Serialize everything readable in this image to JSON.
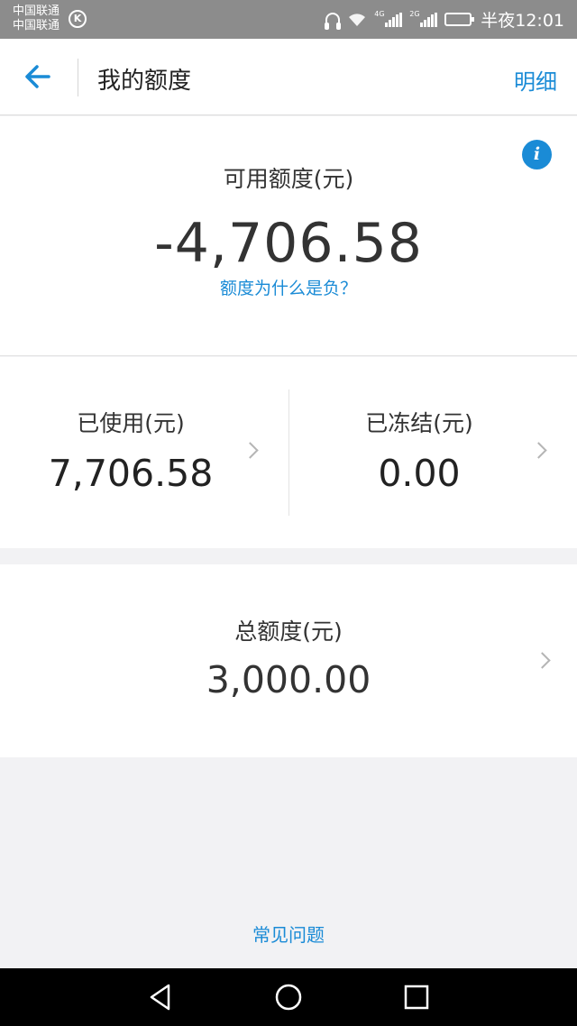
{
  "status_bar": {
    "carrier_1": "中国联通",
    "carrier_2": "中国联通",
    "k_badge": "K",
    "network_1": "4G",
    "network_2": "2G",
    "time": "半夜12:01"
  },
  "header": {
    "title": "我的额度",
    "detail_label": "明细"
  },
  "available": {
    "label": "可用额度(元)",
    "value": "-4,706.58",
    "why_link": "额度为什么是负？",
    "info_icon": "i"
  },
  "used": {
    "label": "已使用(元)",
    "value": "7,706.58"
  },
  "frozen": {
    "label": "已冻结(元)",
    "value": "0.00"
  },
  "total": {
    "label": "总额度(元)",
    "value": "3,000.00"
  },
  "faq": {
    "label": "常见问题"
  },
  "colors": {
    "accent": "#1a8bd6",
    "status_bar": "#8c8c8c",
    "background": "#f2f2f4"
  },
  "icons": {
    "back": "arrow-left-icon",
    "info": "info-icon",
    "chevron": "chevron-right-icon",
    "nav_back": "triangle-back-icon",
    "nav_home": "circle-home-icon",
    "nav_recent": "square-recent-icon"
  }
}
